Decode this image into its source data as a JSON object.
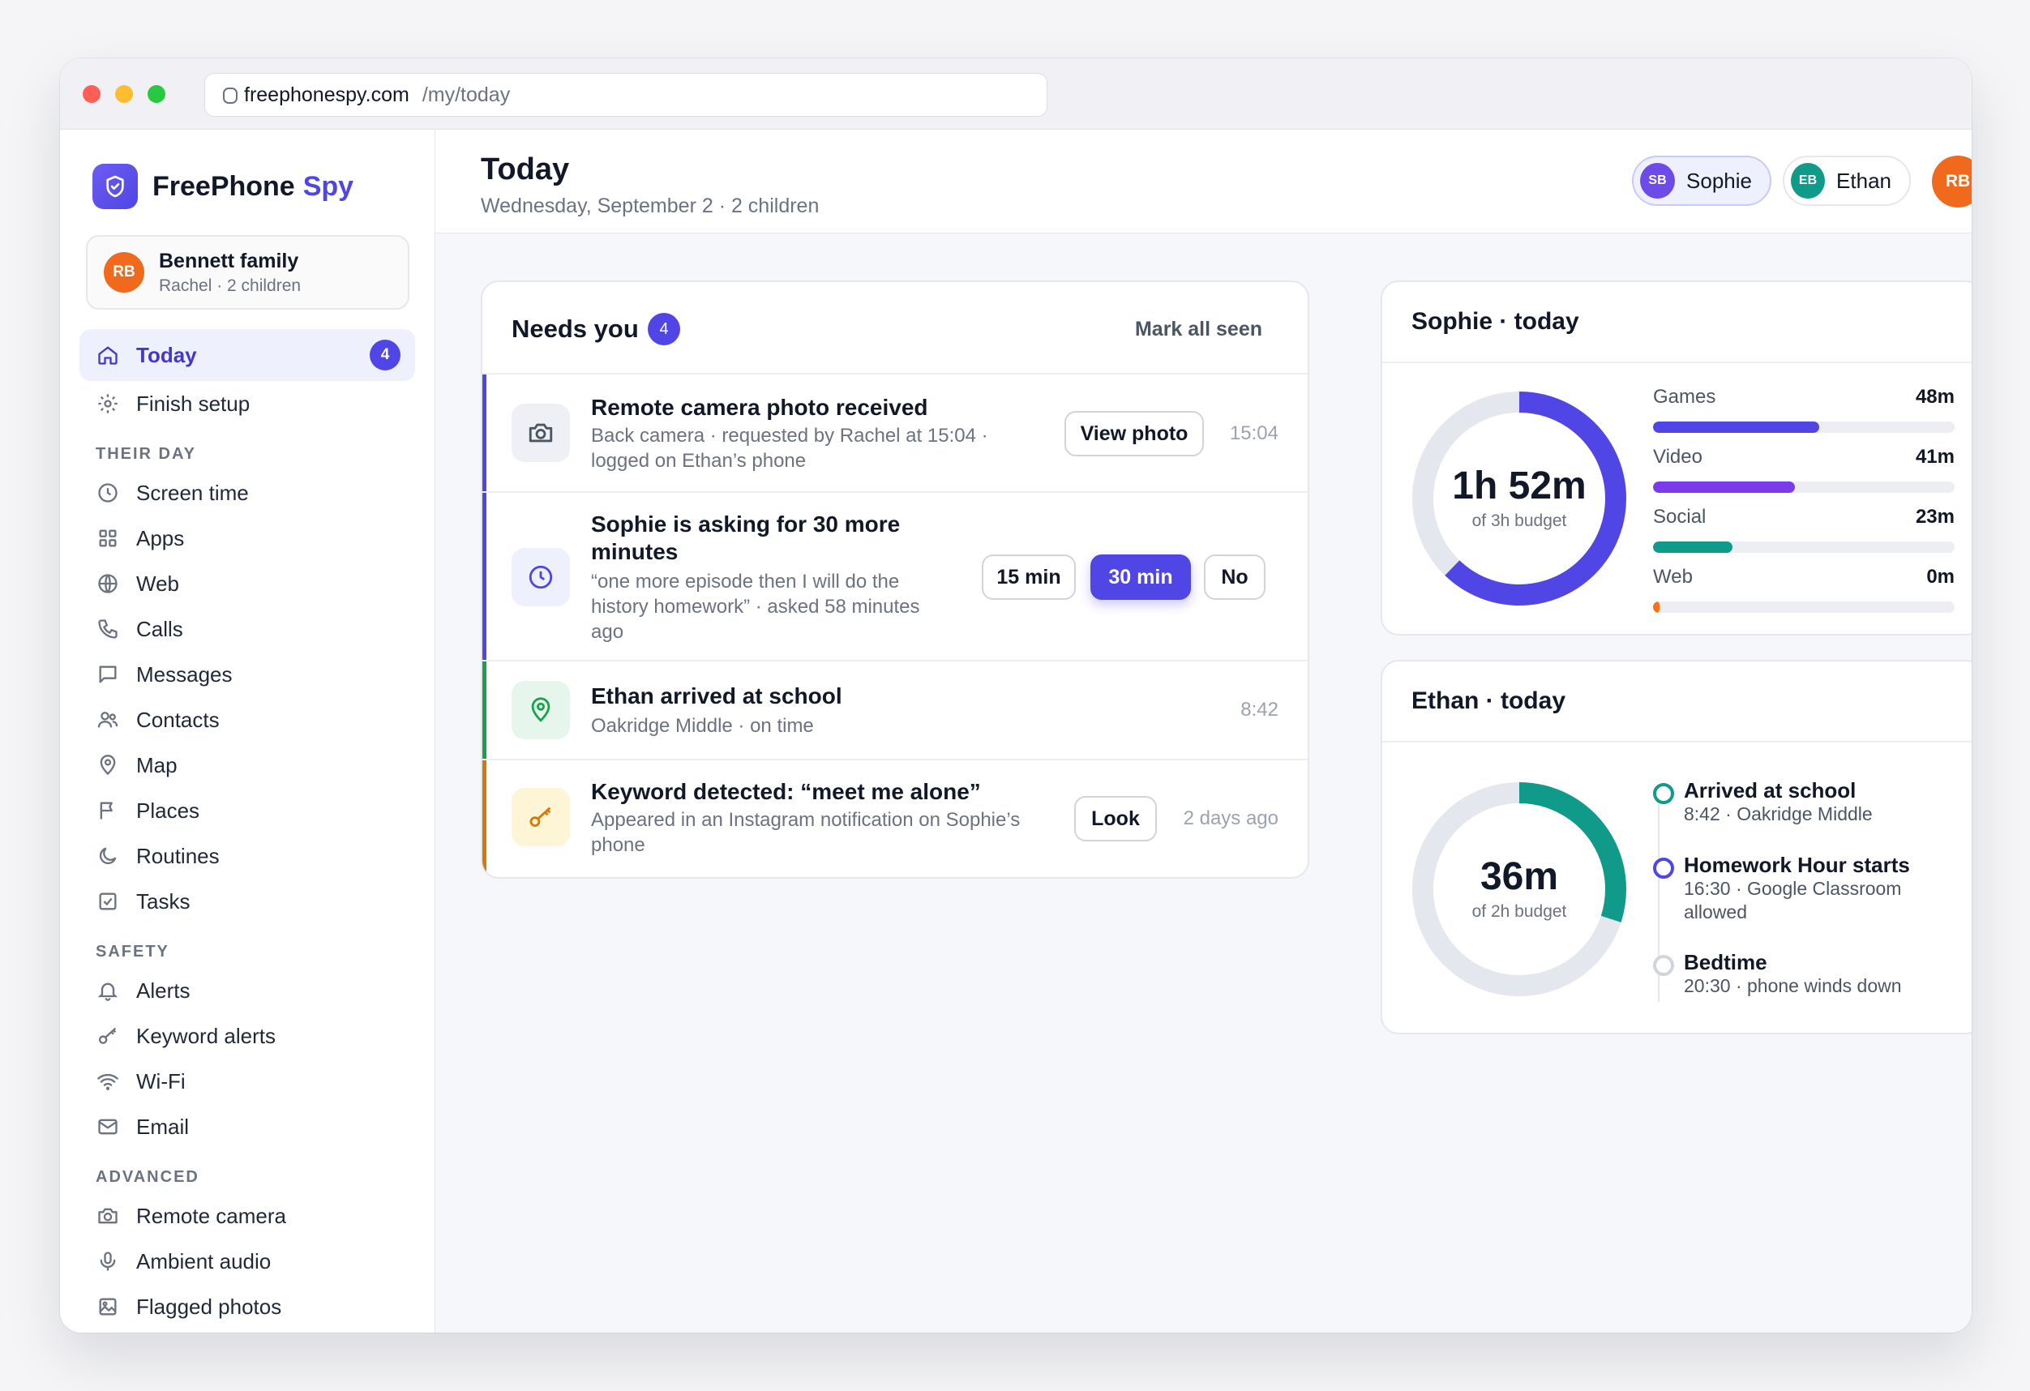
{
  "browser": {
    "host": "freephonespy.com",
    "path": "/my/today"
  },
  "brand": {
    "name": "FreePhone",
    "accent": "Spy"
  },
  "family": {
    "initials": "RB",
    "title": "Bennett family",
    "subtitle": "Rachel · 2 children"
  },
  "nav": {
    "today": {
      "label": "Today",
      "badge": "4"
    },
    "finish_setup": "Finish setup",
    "section_their_day": "THEIR DAY",
    "screen_time": "Screen time",
    "apps": "Apps",
    "web": "Web",
    "calls": "Calls",
    "messages": "Messages",
    "contacts": "Contacts",
    "map": "Map",
    "places": "Places",
    "routines": "Routines",
    "tasks": "Tasks",
    "section_safety": "SAFETY",
    "alerts": "Alerts",
    "keyword_alerts": "Keyword alerts",
    "wifi": "Wi-Fi",
    "email": "Email",
    "section_advanced": "ADVANCED",
    "remote_camera": "Remote camera",
    "ambient_audio": "Ambient audio",
    "flagged_photos": "Flagged photos"
  },
  "header": {
    "title": "Today",
    "subtitle": "Wednesday, September 2 · 2 children",
    "children": [
      {
        "initials": "SB",
        "name": "Sophie"
      },
      {
        "initials": "EB",
        "name": "Ethan"
      }
    ],
    "user_initials": "RB"
  },
  "needs_you": {
    "title": "Needs you",
    "count": "4",
    "mark_all": "Mark all seen",
    "items": [
      {
        "title": "Remote camera photo received",
        "subtitle_1": "Back camera · requested by Rachel at 15:04 ·",
        "subtitle_2": "logged on Ethan’s phone",
        "action": "View photo",
        "time": "15:04"
      },
      {
        "title_1": "Sophie is asking for 30 more",
        "title_2": "minutes",
        "subtitle_1": "“one more episode then I will do the",
        "subtitle_2": "history homework” · asked 58 minutes",
        "subtitle_3": "ago",
        "options": [
          "15 min",
          "30 min",
          "No"
        ]
      },
      {
        "title": "Ethan arrived at school",
        "subtitle": "Oakridge Middle · on time",
        "time": "8:42"
      },
      {
        "title": "Keyword detected: “meet me alone”",
        "subtitle_1": "Appeared in an Instagram notification on Sophie’s",
        "subtitle_2": "phone",
        "action": "Look",
        "time": "2 days ago"
      }
    ]
  },
  "sophie_today": {
    "title": "Sophie · today",
    "total": "1h 52m",
    "budget": "of 3h budget",
    "fraction_used": 0.622,
    "categories": [
      {
        "label": "Games",
        "value": "48m",
        "minutes": 48,
        "color": "#4f46e5"
      },
      {
        "label": "Video",
        "value": "41m",
        "minutes": 41,
        "color": "#7c3aed"
      },
      {
        "label": "Social",
        "value": "23m",
        "minutes": 23,
        "color": "#0f9a8a"
      },
      {
        "label": "Web",
        "value": "0m",
        "minutes": 0,
        "color": "#f97316"
      }
    ]
  },
  "ethan_today": {
    "title": "Ethan · today",
    "total": "36m",
    "budget": "of 2h budget",
    "fraction_used": 0.3,
    "events": [
      {
        "title": "Arrived at school",
        "subtitle": "8:42 · Oakridge Middle",
        "status": "done"
      },
      {
        "title": "Homework Hour starts",
        "subtitle_1": "16:30 · Google Classroom",
        "subtitle_2": "allowed",
        "status": "next"
      },
      {
        "title": "Bedtime",
        "subtitle": "20:30 · phone winds down",
        "status": "later"
      }
    ]
  },
  "colors": {
    "accent": "#4f46e5",
    "teal": "#0f9a8a",
    "orange": "#f06a1d",
    "track": "#e5e7ee"
  }
}
